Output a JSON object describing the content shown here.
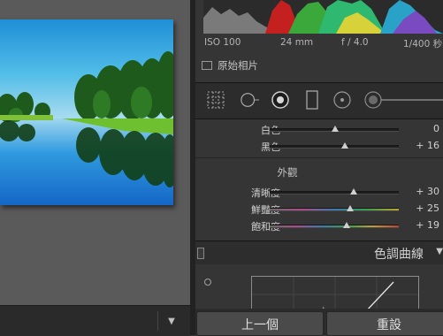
{
  "exif": {
    "iso": "ISO 100",
    "focal": "24 mm",
    "aperture": "f / 4.0",
    "shutter": "1/400 秒"
  },
  "original_photo": {
    "label": "原始相片"
  },
  "tone": {
    "whites": {
      "label": "白色",
      "value": "0",
      "level": 0.51
    },
    "blacks": {
      "label": "黑色",
      "value": "+ 16",
      "level": 0.58
    }
  },
  "presence": {
    "title": "外觀",
    "clarity": {
      "label": "清晰度",
      "value": "+ 30",
      "level": 0.65
    },
    "vibrance": {
      "label": "鮮豔度",
      "value": "+ 25",
      "level": 0.62
    },
    "saturation": {
      "label": "飽和度",
      "value": "+ 19",
      "level": 0.595
    }
  },
  "tone_curve": {
    "title": "色調曲線"
  },
  "buttons": {
    "previous": "上一個",
    "reset": "重設"
  },
  "colors": {
    "accent_red": "#e2231a",
    "panel_bg": "#353535",
    "canvas_bg": "#5a5a5a"
  }
}
